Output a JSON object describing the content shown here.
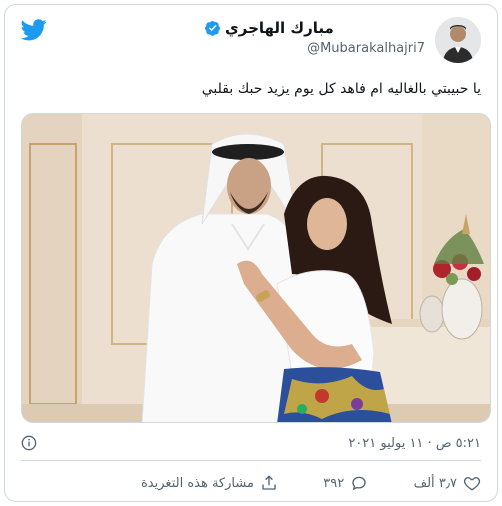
{
  "author": {
    "display_name": "مبارك الهاجري",
    "handle": "@Mubarakalhajri7",
    "verified": true,
    "avatar_icon": "profile-photo"
  },
  "brand": {
    "icon": "twitter-bird-icon",
    "color": "#1d9bf0"
  },
  "tweet": {
    "text": "يا حبيبتي بالغاليه ام فاهد كل يوم يزيد حبك بقلبي",
    "timestamp": "٥:٢١ ص · ١١ يوليو ٢٠٢١",
    "media": {
      "icon": "photo-couple"
    }
  },
  "actions": {
    "likes": "٣٫٧ ألف",
    "replies": "٣٩٢",
    "share_label": "مشاركة هذه التغريدة"
  },
  "colors": {
    "text": "#0f1419",
    "muted": "#536471",
    "border": "#cfd9de",
    "accent": "#1d9bf0"
  }
}
